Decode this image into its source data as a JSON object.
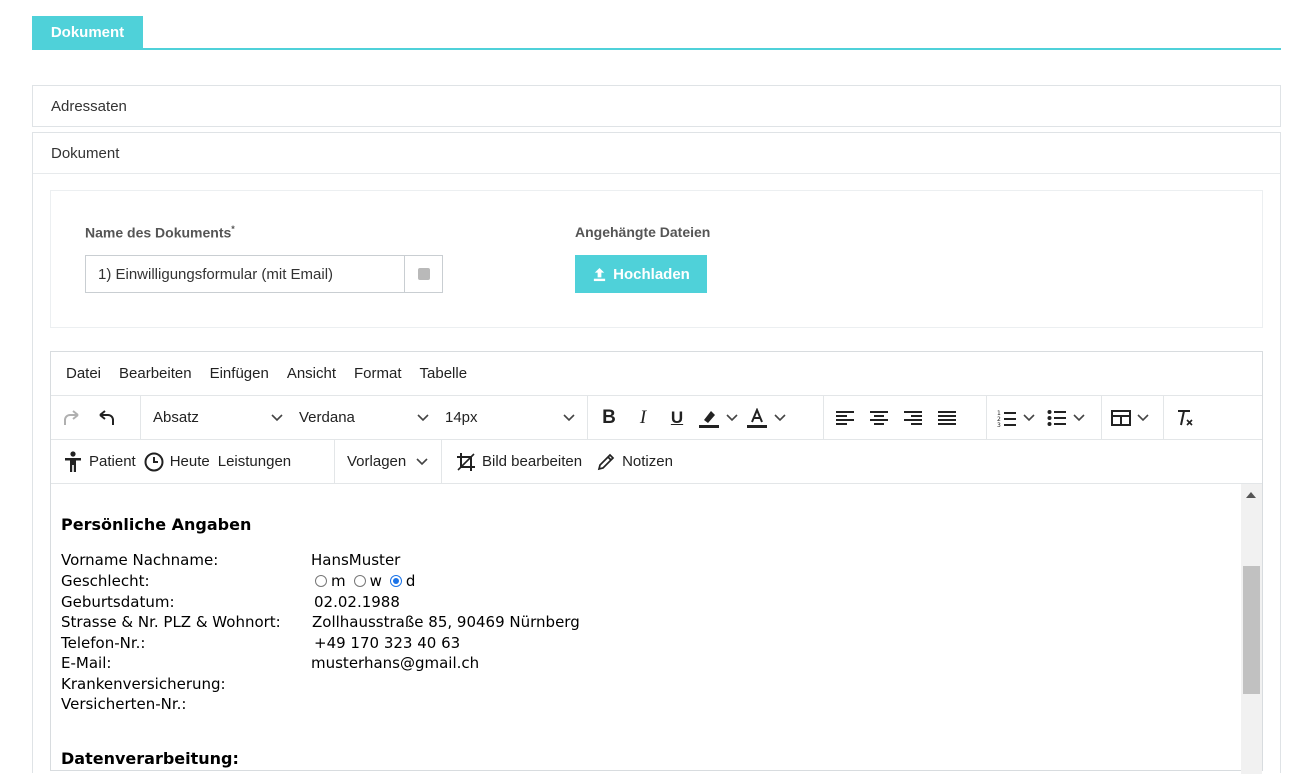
{
  "tabs": {
    "active": "Dokument"
  },
  "panels": {
    "addressees": "Adressaten",
    "document": "Dokument"
  },
  "form": {
    "name_label": "Name des Dokuments",
    "name_required_mark": "*",
    "name_value": "1) Einwilligungsformular (mit Email)",
    "attachments_label": "Angehängte Dateien",
    "upload_label": "Hochladen"
  },
  "editor": {
    "menu": [
      "Datei",
      "Bearbeiten",
      "Einfügen",
      "Ansicht",
      "Format",
      "Tabelle"
    ],
    "block_format": "Absatz",
    "font_family": "Verdana",
    "font_size": "14px",
    "custom": {
      "patient": "Patient",
      "today": "Heute",
      "services": "Leistungen",
      "templates": "Vorlagen",
      "edit_image": "Bild bearbeiten",
      "notes": "Notizen"
    },
    "colors": {
      "accent": "#4fd1d9",
      "radio_checked": "#1a73e8"
    }
  },
  "content": {
    "section1_title": "Persönliche Angaben",
    "fields": [
      {
        "label": "Vorname Nachname:",
        "value": "HansMuster"
      },
      {
        "label": "Geschlecht:",
        "value": ""
      },
      {
        "label": "Geburtsdatum:",
        "value": "02.02.1988"
      },
      {
        "label": "Strasse & Nr. PLZ & Wohnort:",
        "value": "Zollhausstraße 85, 90469 Nürnberg"
      },
      {
        "label": "Telefon-Nr.:",
        "value": "+49 170 323 40 63"
      },
      {
        "label": "E-Mail:",
        "value": "musterhans@gmail.ch"
      },
      {
        "label": "Krankenversicherung:",
        "value": ""
      },
      {
        "label": "Versicherten-Nr.:",
        "value": ""
      }
    ],
    "gender_options": [
      {
        "label": "m",
        "checked": false
      },
      {
        "label": "w",
        "checked": false
      },
      {
        "label": "d",
        "checked": true
      }
    ],
    "section2_title": "Datenverarbeitung:"
  }
}
